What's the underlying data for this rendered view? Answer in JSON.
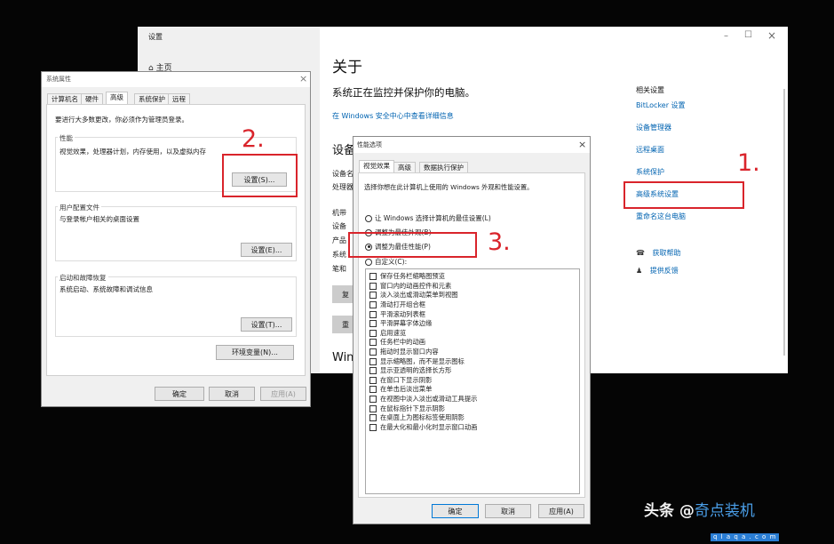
{
  "settings": {
    "window_title": "设置",
    "home": "主页",
    "minimize": "–",
    "maximize": "☐",
    "close": "×",
    "heading": "关于",
    "protect_status": "系统正在监控并保护你的电脑。",
    "security_link": "在 Windows 安全中心中查看详细信息",
    "device_spec_heading": "设备",
    "spec_labels": [
      "设备名",
      "处理器",
      "机带 RAM",
      "设备 ID",
      "产品 ID",
      "系统类型",
      "笔和触控"
    ],
    "spec_labels_cut": [
      "设备名",
      "处理器",
      "机带",
      "设备",
      "产品",
      "系统",
      "笔和"
    ],
    "rename_button": "重",
    "copy_button": "复",
    "windows_spec_cut": "Win",
    "related_heading": "相关设置",
    "related_links": [
      "BitLocker 设置",
      "设备管理器",
      "远程桌面",
      "系统保护",
      "高级系统设置",
      "重命名这台电脑"
    ],
    "help_links": [
      "获取帮助",
      "提供反馈"
    ]
  },
  "sysprops": {
    "title": "系统属性",
    "close": "×",
    "tabs": [
      "计算机名",
      "硬件",
      "高级",
      "系统保护",
      "远程"
    ],
    "active_tab": "高级",
    "admin_note": "要进行大多数更改，你必须作为管理员登录。",
    "perf_title": "性能",
    "perf_desc": "视觉效果，处理器计划，内存使用，以及虚拟内存",
    "perf_button": "设置(S)...",
    "profile_title": "用户配置文件",
    "profile_desc": "与登录帐户相关的桌面设置",
    "profile_button": "设置(E)...",
    "startup_title": "启动和故障恢复",
    "startup_desc": "系统启动、系统故障和调试信息",
    "startup_button": "设置(T)...",
    "env_button": "环境变量(N)...",
    "ok": "确定",
    "cancel": "取消",
    "apply": "应用(A)"
  },
  "perfopts": {
    "title": "性能选项",
    "close": "×",
    "tabs": [
      "视觉效果",
      "高级",
      "数据执行保护"
    ],
    "active_tab": "视觉效果",
    "instruction": "选择你想在此计算机上使用的 Windows 外观和性能设置。",
    "radios": [
      "让 Windows 选择计算机的最佳设置(L)",
      "调整为最佳外观(B)",
      "调整为最佳性能(P)",
      "自定义(C):"
    ],
    "selected_radio": "调整为最佳性能(P)",
    "checkboxes": [
      "保存任务栏缩略图预览",
      "窗口内的动画控件和元素",
      "淡入淡出或滑动菜单到视图",
      "滑动打开组合框",
      "平滑滚动列表框",
      "平滑屏幕字体边缘",
      "启用速览",
      "任务栏中的动画",
      "拖动时显示窗口内容",
      "显示缩略图，而不是显示图标",
      "显示亚透明的选择长方形",
      "在窗口下显示阴影",
      "在单击后淡出菜单",
      "在视图中淡入淡出或滑动工具提示",
      "在鼠标指针下显示阴影",
      "在桌面上为图标标签使用阴影",
      "在最大化和最小化时显示窗口动画"
    ],
    "ok": "确定",
    "cancel": "取消",
    "apply": "应用(A)"
  },
  "annotations": {
    "step1": "1.",
    "step2": "2.",
    "step3": "3.",
    "accent_color": "#d9242b"
  },
  "watermark": {
    "text": "头条 @",
    "brand": "奇点装机",
    "url": "q l a q a . c o m"
  }
}
